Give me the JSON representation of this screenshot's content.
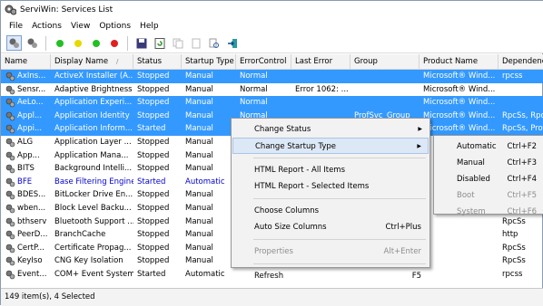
{
  "title": "ServiWin: Services List",
  "menu": [
    "File",
    "Actions",
    "View",
    "Options",
    "Help"
  ],
  "columns": [
    "Name",
    "Display Name",
    "Status",
    "Startup Type",
    "ErrorControl",
    "Last Error",
    "Group",
    "Product Name",
    "Dependencies"
  ],
  "rows": [
    {
      "sel": true,
      "c": [
        "AxIns...",
        "ActiveX Installer (A...",
        "Stopped",
        "Manual",
        "Normal",
        "",
        "",
        "Microsoft® Wind...",
        "rpcss"
      ]
    },
    {
      "sel": false,
      "c": [
        "Sensr...",
        "Adaptive Brightness",
        "Stopped",
        "Manual",
        "Normal",
        "Error 1062: ...",
        "",
        "Microsoft® Wind...",
        ""
      ]
    },
    {
      "sel": true,
      "c": [
        "AeLo...",
        "Application Experi...",
        "Stopped",
        "Manual",
        "Normal",
        "",
        "",
        "Microsoft® Wind...",
        ""
      ]
    },
    {
      "sel": true,
      "c": [
        "Appl...",
        "Application Identity",
        "Stopped",
        "Manual",
        "Normal",
        "",
        "ProfSvc_Group",
        "Microsoft® Wind...",
        "RpcSs, RpcSs"
      ]
    },
    {
      "sel": true,
      "c": [
        "Appi...",
        "Application Inform...",
        "Started",
        "Manual",
        "Normal",
        "",
        "",
        "Microsoft® Wind...",
        "RpcSs, Prof"
      ]
    },
    {
      "sel": false,
      "c": [
        "ALG",
        "Application Layer ...",
        "Stopped",
        "Manual",
        "",
        "",
        "",
        "",
        ""
      ]
    },
    {
      "sel": false,
      "c": [
        "App...",
        "Application Mana...",
        "Stopped",
        "Manual",
        "",
        "",
        "",
        "",
        ""
      ]
    },
    {
      "sel": false,
      "c": [
        "BITS",
        "Background Intelli...",
        "Stopped",
        "Manual",
        "",
        "",
        "",
        "",
        ""
      ]
    },
    {
      "sel": false,
      "blue": true,
      "c": [
        "BFE",
        "Base Filtering Engine",
        "Started",
        "Automatic",
        "",
        "",
        "",
        "",
        ""
      ]
    },
    {
      "sel": false,
      "c": [
        "BDES...",
        "BitLocker Drive En...",
        "Stopped",
        "Manual",
        "",
        "",
        "",
        "",
        ""
      ]
    },
    {
      "sel": false,
      "c": [
        "wben...",
        "Block Level Backu...",
        "Stopped",
        "Manual",
        "",
        "",
        "",
        "",
        ""
      ]
    },
    {
      "sel": false,
      "c": [
        "bthserv",
        "Bluetooth Support ...",
        "Stopped",
        "Manual",
        "",
        "",
        "",
        "",
        "RpcSs"
      ]
    },
    {
      "sel": false,
      "c": [
        "PeerD...",
        "BranchCache",
        "Stopped",
        "Manual",
        "",
        "",
        "",
        "",
        "http"
      ]
    },
    {
      "sel": false,
      "c": [
        "CertP...",
        "Certificate Propag...",
        "Stopped",
        "Manual",
        "",
        "",
        "",
        "",
        "RpcSs"
      ]
    },
    {
      "sel": false,
      "c": [
        "KeyIso",
        "CNG Key Isolation",
        "Stopped",
        "Manual",
        "",
        "",
        "",
        "",
        "RpcSs"
      ]
    },
    {
      "sel": false,
      "c": [
        "Event...",
        "COM+ Event System",
        "Started",
        "Automatic",
        "",
        "",
        "",
        "",
        "rpcss"
      ]
    }
  ],
  "status": "149 item(s), 4 Selected",
  "context_menu": [
    {
      "label": "Change Status",
      "sub": true
    },
    {
      "label": "Change Startup Type",
      "sub": true,
      "hl": true
    },
    {
      "sep": true
    },
    {
      "label": "HTML Report - All Items"
    },
    {
      "label": "HTML Report - Selected Items"
    },
    {
      "sep": true
    },
    {
      "label": "Choose Columns"
    },
    {
      "label": "Auto Size Columns",
      "sc": "Ctrl+Plus"
    },
    {
      "sep": true
    },
    {
      "label": "Properties",
      "sc": "Alt+Enter",
      "dis": true
    },
    {
      "sep": true
    },
    {
      "label": "Refresh",
      "sc": "F5"
    }
  ],
  "submenu": [
    {
      "label": "Automatic",
      "sc": "Ctrl+F2"
    },
    {
      "label": "Manual",
      "sc": "Ctrl+F3"
    },
    {
      "label": "Disabled",
      "sc": "Ctrl+F4"
    },
    {
      "label": "Boot",
      "sc": "Ctrl+F5",
      "dis": true
    },
    {
      "label": "System",
      "sc": "Ctrl+F6",
      "dis": true
    }
  ],
  "colors": {
    "selection": "#3399ff",
    "blue_text": "#0000d0",
    "dot_green": "#22c022",
    "dot_yellow": "#e8d800",
    "dot_red": "#e02020"
  }
}
